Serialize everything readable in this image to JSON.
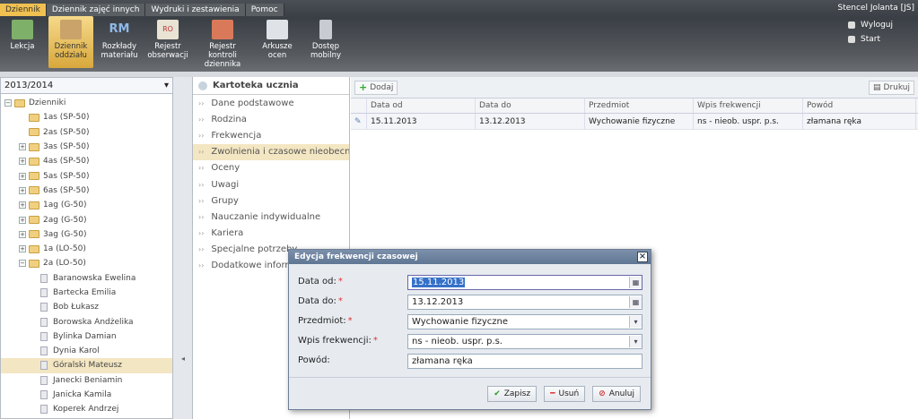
{
  "tabs": [
    "Dziennik",
    "Dziennik zajęć innych",
    "Wydruki i zestawienia",
    "Pomoc"
  ],
  "user": "Stencel Jolanta [JS]",
  "toolbar": [
    "Lekcja",
    "Dziennik oddziału",
    "Rozkłady materiału",
    "Rejestr obserwacji",
    "Rejestr kontroli dziennika",
    "Arkusze ocen",
    "Dostęp mobilny"
  ],
  "toolbar_icon_text": {
    "rozklady": "RM",
    "rejestr": "RO"
  },
  "side_links": [
    "Wyloguj",
    "Start"
  ],
  "year": "2013/2014",
  "tree": {
    "root": "Dzienniki",
    "classes": [
      "1as (SP-50)",
      "2as (SP-50)",
      "3as (SP-50)",
      "4as (SP-50)",
      "5as (SP-50)",
      "6as (SP-50)",
      "1ag (G-50)",
      "2ag (G-50)",
      "3ag (G-50)",
      "1a (LO-50)",
      "2a (LO-50)"
    ],
    "students": [
      "Baranowska Ewelina",
      "Bartecka Emilia",
      "Bob Łukasz",
      "Borowska Andżelika",
      "Bylinka Damian",
      "Dynia Karol",
      "Góralski Mateusz",
      "Janecki Beniamin",
      "Janicka Kamila",
      "Koperek Andrzej"
    ]
  },
  "mid": {
    "title": "Kartoteka ucznia",
    "items": [
      "Dane podstawowe",
      "Rodzina",
      "Frekwencja",
      "Zwolnienia i czasowe nieobecności",
      "Oceny",
      "Uwagi",
      "Grupy",
      "Nauczanie indywidualne",
      "Kariera",
      "Specjalne potrzeby",
      "Dodatkowe informacje"
    ]
  },
  "grid": {
    "add": "Dodaj",
    "print": "Drukuj",
    "headers": [
      "Data od",
      "Data do",
      "Przedmiot",
      "Wpis frekwencji",
      "Powód"
    ],
    "rows": [
      [
        "15.11.2013",
        "13.12.2013",
        "Wychowanie fizyczne",
        "ns - nieob. uspr. p.s.",
        "złamana ręka"
      ]
    ]
  },
  "dialog": {
    "title": "Edycja frekwencji czasowej",
    "labels": [
      "Data od:",
      "Data do:",
      "Przedmiot:",
      "Wpis frekwencji:",
      "Powód:"
    ],
    "values": [
      "15.11.2013",
      "13.12.2013",
      "Wychowanie fizyczne",
      "ns - nieob. uspr. p.s.",
      "złamana ręka"
    ],
    "save": "Zapisz",
    "delete": "Usuń",
    "cancel": "Anuluj"
  }
}
